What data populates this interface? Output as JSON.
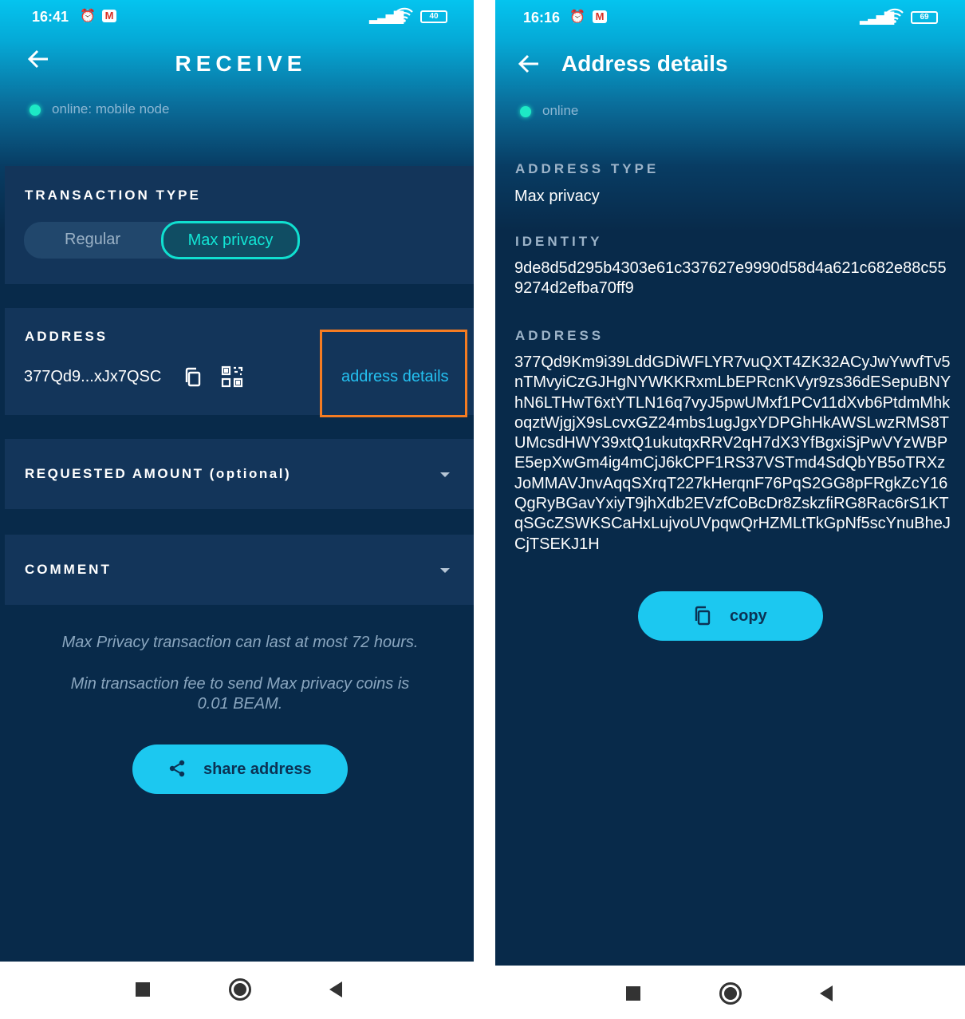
{
  "left": {
    "status": {
      "time": "16:41",
      "battery": "40"
    },
    "header": {
      "title": "RECEIVE"
    },
    "online": "online: mobile node",
    "transaction_type": {
      "title": "TRANSACTION TYPE",
      "options": [
        "Regular",
        "Max privacy"
      ],
      "selected": "Max privacy"
    },
    "address": {
      "title": "ADDRESS",
      "value": "377Qd9...xJx7QSC",
      "details_link": "address details"
    },
    "requested_amount": {
      "title": "REQUESTED AMOUNT (optional)"
    },
    "comment": {
      "title": "COMMENT"
    },
    "notes": [
      "Max Privacy transaction can last at most 72 hours.",
      "Min transaction fee to send Max privacy coins is 0.01 BEAM."
    ],
    "share_button": "share address"
  },
  "right": {
    "status": {
      "time": "16:16",
      "battery": "69"
    },
    "header": {
      "title": "Address details"
    },
    "online": "online",
    "address_type": {
      "label": "ADDRESS TYPE",
      "value": "Max privacy"
    },
    "identity": {
      "label": "IDENTITY",
      "value": "9de8d5d295b4303e61c337627e9990d58d4a621c682e88c559274d2efba70ff9"
    },
    "address": {
      "label": "ADDRESS",
      "value": "377Qd9Km9i39LddGDiWFLYR7vuQXT4ZK32ACyJwYwvfTv5nTMvyiCzGJHgNYWKKRxmLbEPRcnKVyr9zs36dESepuBNYhN6LTHwT6xtYTLN16q7vyJ5pwUMxf1PCv11dXvb6PtdmMhkoqztWjgjX9sLcvxGZ24mbs1ugJgxYDPGhHkAWSLwzRMS8TUMcsdHWY39xtQ1ukutqxRRV2qH7dX3YfBgxiSjPwVYzWBPE5epXwGm4ig4mCjJ6kCPF1RS37VSTmd4SdQbYB5oTRXzJoMMAVJnvAqqSXrqT227kHerqnF76PqS2GG8pFRgkZcY16QgRyBGavYxiyT9jhXdb2EVzfCoBcDr8ZskzfiRG8Rac6rS1KTqSGcZSWKSCaHxLujvoUVpqwQrHZMLtTkGpNf5scYnuBheJCjTSEKJ1H"
    },
    "copy_button": "copy"
  },
  "colors": {
    "accent": "#1cc8f0",
    "bg": "#082a4a",
    "highlight": "#f57c22",
    "online": "#1de9c5"
  }
}
